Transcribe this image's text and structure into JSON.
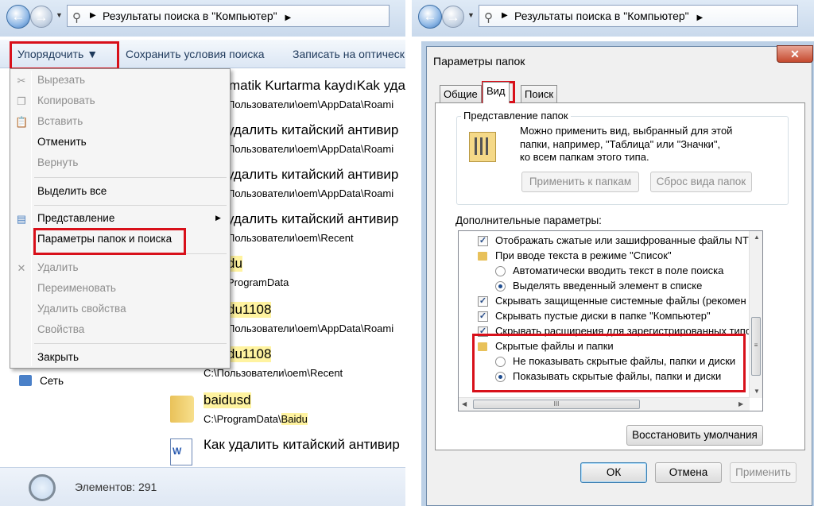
{
  "explorer": {
    "breadcrumb": "Результаты поиска в \"Компьютер\"",
    "toolbar": {
      "organize": "Упорядочить ▼",
      "save_search": "Сохранить условия поиска",
      "burn": "Записать на оптическ"
    },
    "menu": {
      "items": [
        {
          "label": "Вырезать"
        },
        {
          "label": "Копировать"
        },
        {
          "label": "Вставить"
        },
        {
          "label": "Отменить"
        },
        {
          "label": "Вернуть"
        },
        {
          "label": "Выделить все"
        },
        {
          "label": "Представление"
        },
        {
          "label": "Параметры папок и поиска"
        },
        {
          "label": "Удалить"
        },
        {
          "label": "Переименовать"
        },
        {
          "label": "Удалить свойства"
        },
        {
          "label": "Свойства"
        },
        {
          "label": "Закрыть"
        }
      ]
    },
    "files": [
      {
        "name": "matik Kurtarma kaydıKak уда",
        "path": "Пользователи\\oem\\AppData\\Roami"
      },
      {
        "name": "удалить китайский антивир",
        "path": "Пользователи\\oem\\AppData\\Roami"
      },
      {
        "name": "удалить китайский антивир",
        "path": "Пользователи\\oem\\AppData\\Roami"
      },
      {
        "name": "удалить китайский антивир",
        "path": "Пользователи\\oem\\Recent"
      },
      {
        "name": "du",
        "path": "ProgramData"
      },
      {
        "name": "du1108",
        "path": "Пользователи\\oem\\AppData\\Roami"
      },
      {
        "name": "du1108",
        "path": "C:\\Пользователи\\oem\\Recent"
      },
      {
        "name": "baidusd",
        "path_prefix": "C:\\ProgramData\\",
        "path_hl": "Baidu"
      },
      {
        "name": "Как удалить китайский антивир",
        "path": ""
      }
    ],
    "network": "Сеть",
    "status": "Элементов: 291"
  },
  "dialog": {
    "breadcrumb": "Результаты поиска в \"Компьютер\"",
    "title": "Параметры папок",
    "close": "✕",
    "tabs": [
      "Общие",
      "Вид",
      "Поиск"
    ],
    "folder_view": {
      "title": "Представление папок",
      "desc": [
        "Можно применить вид, выбранный для этой",
        "папки, например, \"Таблица\" или \"Значки\",",
        "ко всем папкам этого типа."
      ],
      "apply_btn": "Применить к папкам",
      "reset_btn": "Сброс вида папок"
    },
    "advanced_label": "Дополнительные параметры:",
    "tree": [
      {
        "type": "check",
        "checked": true,
        "label": "Отображать сжатые или зашифрованные файлы NTI"
      },
      {
        "type": "folder",
        "label": "При вводе текста в режиме \"Список\""
      },
      {
        "type": "radio",
        "checked": false,
        "label": "Автоматически вводить текст в поле поиска"
      },
      {
        "type": "radio",
        "checked": true,
        "label": "Выделять введенный элемент в списке"
      },
      {
        "type": "check",
        "checked": true,
        "label": "Скрывать защищенные системные файлы (рекомен"
      },
      {
        "type": "check",
        "checked": true,
        "label": "Скрывать пустые диски в папке \"Компьютер\""
      },
      {
        "type": "check",
        "checked": true,
        "label": "Скрывать расширения для зарегистрированных типо"
      },
      {
        "type": "folder",
        "label": "Скрытые файлы и папки"
      },
      {
        "type": "radio",
        "checked": false,
        "label": "Не показывать скрытые файлы, папки и диски"
      },
      {
        "type": "radio",
        "checked": true,
        "label": "Показывать скрытые файлы, папки и диски"
      }
    ],
    "scroll_glyph_v": "≡",
    "scroll_glyph_h": "III",
    "restore_btn": "Восстановить умолчания",
    "ok_btn": "ОК",
    "cancel_btn": "Отмена",
    "apply_btn": "Применить"
  },
  "colors": {
    "highlight_box": "#d8101a",
    "search_highlight": "#fff3a0"
  }
}
